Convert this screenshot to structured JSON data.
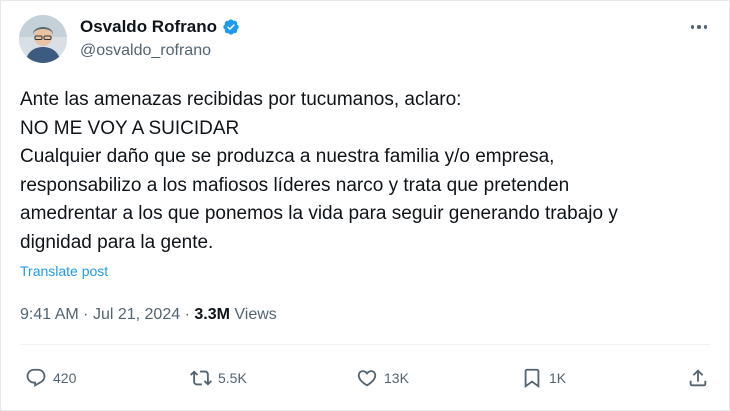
{
  "author": {
    "name": "Osvaldo Rofrano",
    "handle": "@osvaldo_rofrano",
    "verified": true
  },
  "tweet": {
    "lines": [
      "Ante las amenazas recibidas por tucumanos, aclaro:",
      "NO ME VOY A SUICIDAR",
      "Cualquier daño que se produzca a nuestra familia y/o empresa,",
      "responsabilizo a los mafiosos líderes narco y trata que pretenden",
      "amedrentar a los que ponemos la vida para seguir generando trabajo y",
      "dignidad para la gente."
    ],
    "translate_label": "Translate post"
  },
  "meta": {
    "time": "9:41 AM",
    "separator": "·",
    "date": "Jul 21, 2024",
    "views_count": "3.3M",
    "views_label": "Views"
  },
  "actions": {
    "replies": "420",
    "reposts": "5.5K",
    "likes": "13K",
    "bookmarks": "1K"
  },
  "icons": [
    "more-icon",
    "verified-icon",
    "reply-icon",
    "repost-icon",
    "like-icon",
    "bookmark-icon",
    "share-icon"
  ],
  "colors": {
    "accent": "#1d9bf0",
    "text_primary": "#0f1419",
    "text_secondary": "#536471"
  }
}
